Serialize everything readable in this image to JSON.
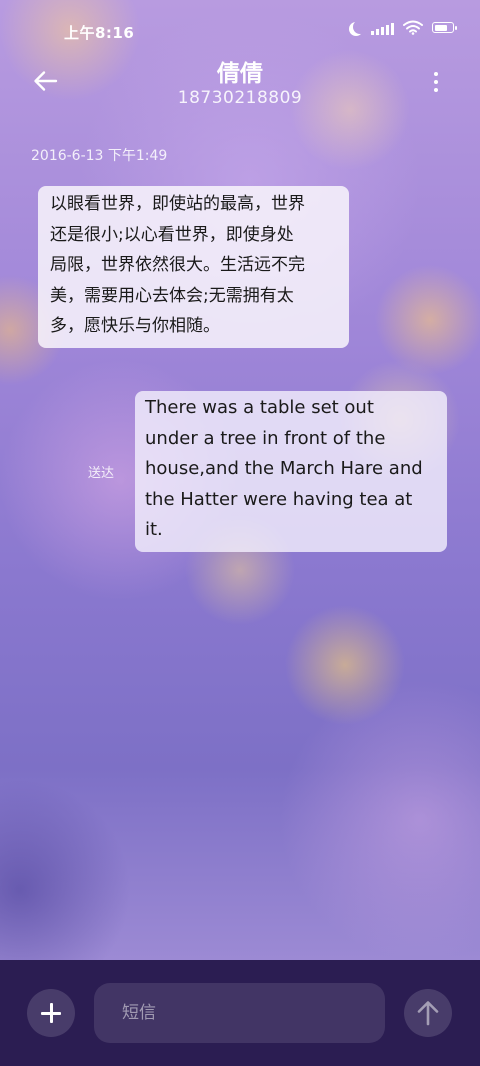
{
  "status_bar": {
    "time": "上午8:16",
    "icons": [
      "moon-icon",
      "signal-icon",
      "wifi-icon",
      "battery-icon"
    ]
  },
  "header": {
    "back_icon": "back-arrow-icon",
    "contact_name": "倩倩",
    "contact_number": "18730218809",
    "more_icon": "more-vertical-icon"
  },
  "conversation": {
    "timestamp": "2016-6-13 下午1:49",
    "incoming_message": {
      "lines": [
        "以眼看世界，即使站的最高，世界",
        "还是很小;以心看世界，即使身处",
        "局限，世界依然很大。生活远不完",
        "美，需要用心去体会;无需拥有太",
        "多，愿快乐与你相随。"
      ]
    },
    "outgoing_message": {
      "lines": [
        "There was a table set out",
        "under a tree in front of the",
        "house,and the March Hare and",
        "the Hatter were having tea at",
        "it."
      ],
      "status": "送达"
    }
  },
  "compose": {
    "add_icon": "plus-icon",
    "placeholder": "短信",
    "value": "",
    "send_icon": "arrow-up-icon"
  },
  "colors": {
    "compose_bar_bg": "#2b1d52",
    "bubble_text": "#1a1a1a",
    "wallpaper_tone": "#9f86d8"
  }
}
